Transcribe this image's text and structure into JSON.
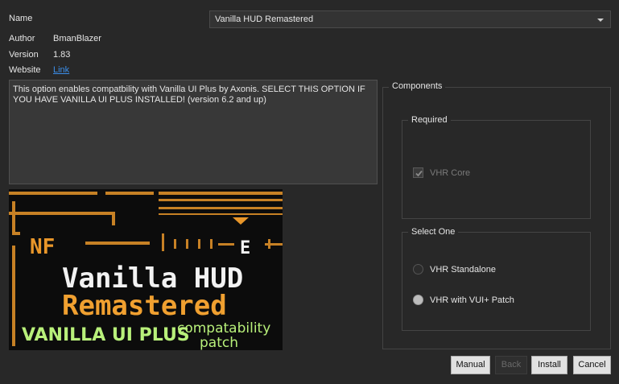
{
  "info": {
    "name_label": "Name",
    "author_label": "Author",
    "author_value": "BmanBlazer",
    "version_label": "Version",
    "version_value": "1.83",
    "website_label": "Website",
    "website_link": "Link"
  },
  "name_select": {
    "selected": "Vanilla HUD Remastered"
  },
  "description": "This option enables compatbility with Vanilla UI Plus by Axonis. SELECT THIS OPTION IF YOU HAVE VANILLA UI PLUS INSTALLED! (version 6.2 and up)",
  "image": {
    "top_letters": "NF",
    "marker_letter": "E",
    "line1": "Vanilla HUD",
    "line2": "Remastered",
    "line3": "VANILLA UI PLUS",
    "line4a": "compatability",
    "line4b": "patch",
    "colors": {
      "orange": "#f0a030",
      "white": "#f2f2f2",
      "green": "#b8f07a"
    }
  },
  "components": {
    "title": "Components",
    "required": {
      "title": "Required",
      "items": [
        {
          "label": "VHR Core",
          "checked": true,
          "enabled": false
        }
      ]
    },
    "select_one": {
      "title": "Select One",
      "options": [
        {
          "label": "VHR Standalone",
          "selected": false
        },
        {
          "label": "VHR with VUI+ Patch",
          "selected": true
        }
      ]
    }
  },
  "buttons": {
    "manual": "Manual",
    "back": "Back",
    "install": "Install",
    "cancel": "Cancel"
  }
}
